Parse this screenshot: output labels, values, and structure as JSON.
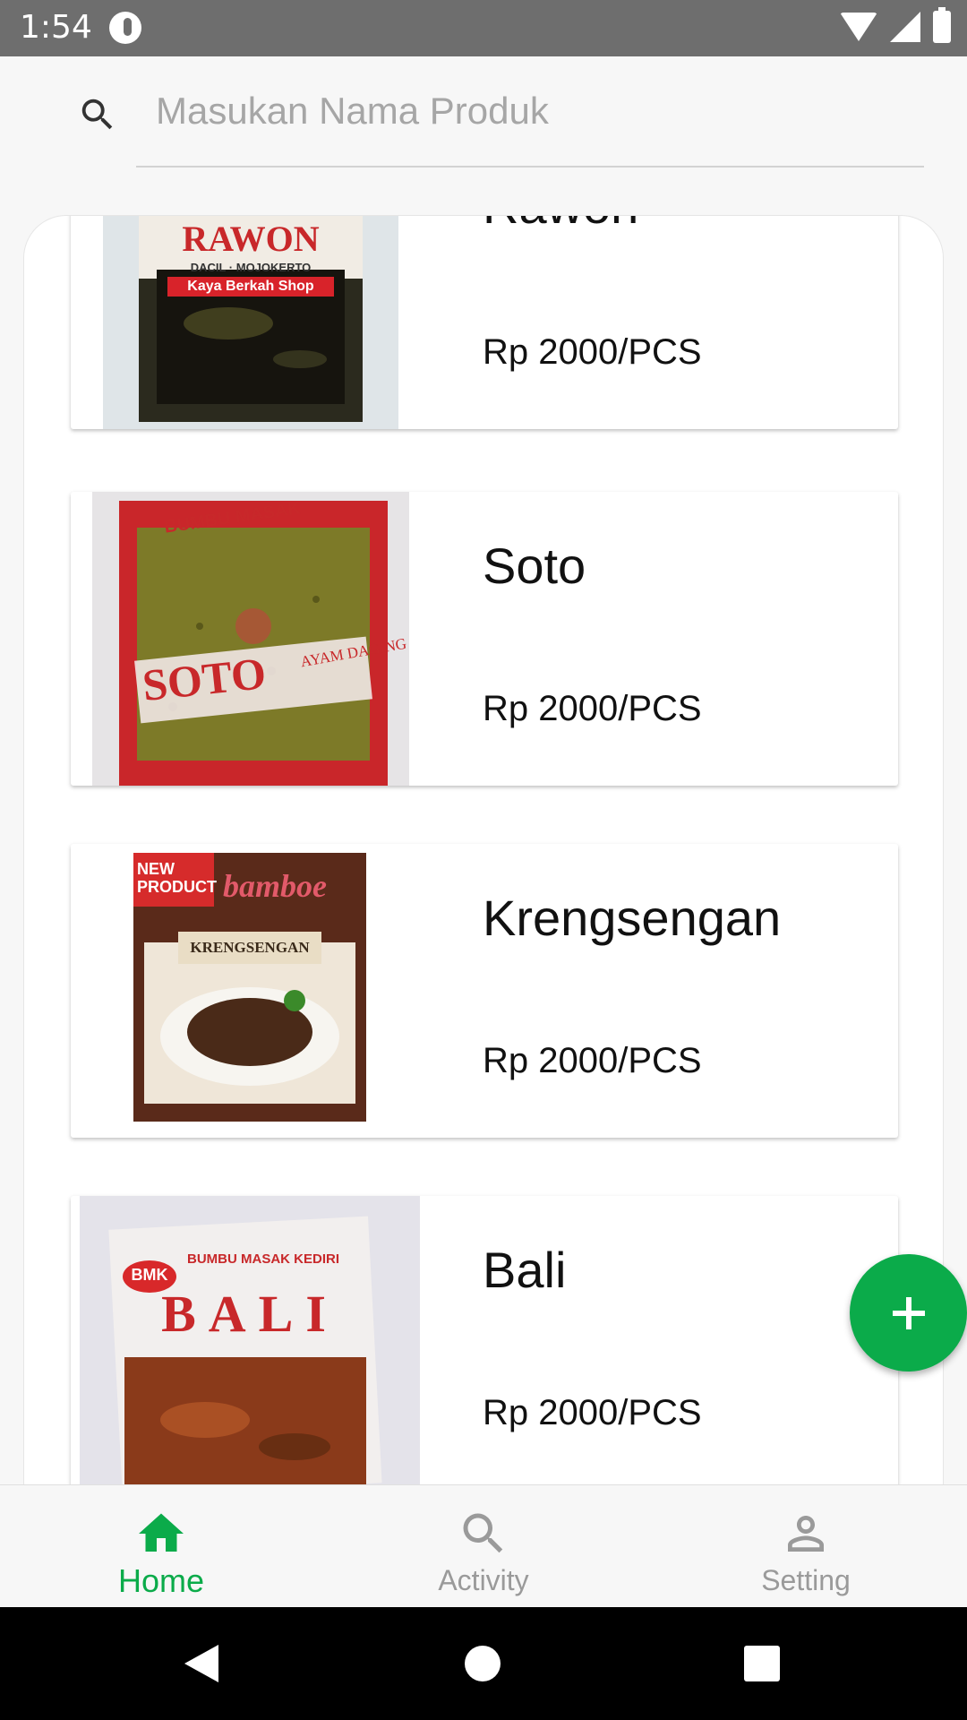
{
  "status_bar": {
    "time": "1:54"
  },
  "search": {
    "placeholder": "Masukan Nama Produk",
    "value": ""
  },
  "products": [
    {
      "name": "Rawon",
      "price": "Rp 2000/PCS",
      "image_label": "RAWON",
      "image_sublabel": "DACIL · MOJOKERTO",
      "image_tag": "Kaya Berkah Shop"
    },
    {
      "name": "Soto",
      "price": "Rp 2000/PCS",
      "image_label": "SOTO",
      "image_sublabel": "BUMBU MASAK",
      "image_tag": "AYAM DAGING"
    },
    {
      "name": "Krengsengan",
      "price": "Rp 2000/PCS",
      "image_label": "KRENGSENGAN",
      "image_sublabel": "bamboe",
      "image_tag": "NEW PRODUCT"
    },
    {
      "name": "Bali",
      "price": "Rp 2000/PCS",
      "image_label": "BALI",
      "image_sublabel": "BUMBU MASAK KEDIRI",
      "image_tag": "BMK"
    }
  ],
  "fab": {
    "icon": "plus-icon"
  },
  "bottom_nav": [
    {
      "label": "Home",
      "icon": "home-icon",
      "active": true
    },
    {
      "label": "Activity",
      "icon": "search-icon",
      "active": false
    },
    {
      "label": "Setting",
      "icon": "person-icon",
      "active": false
    }
  ],
  "colors": {
    "accent": "#0bab4a",
    "inactive": "#9a9a9a",
    "status_bar": "#6e6e6e"
  }
}
